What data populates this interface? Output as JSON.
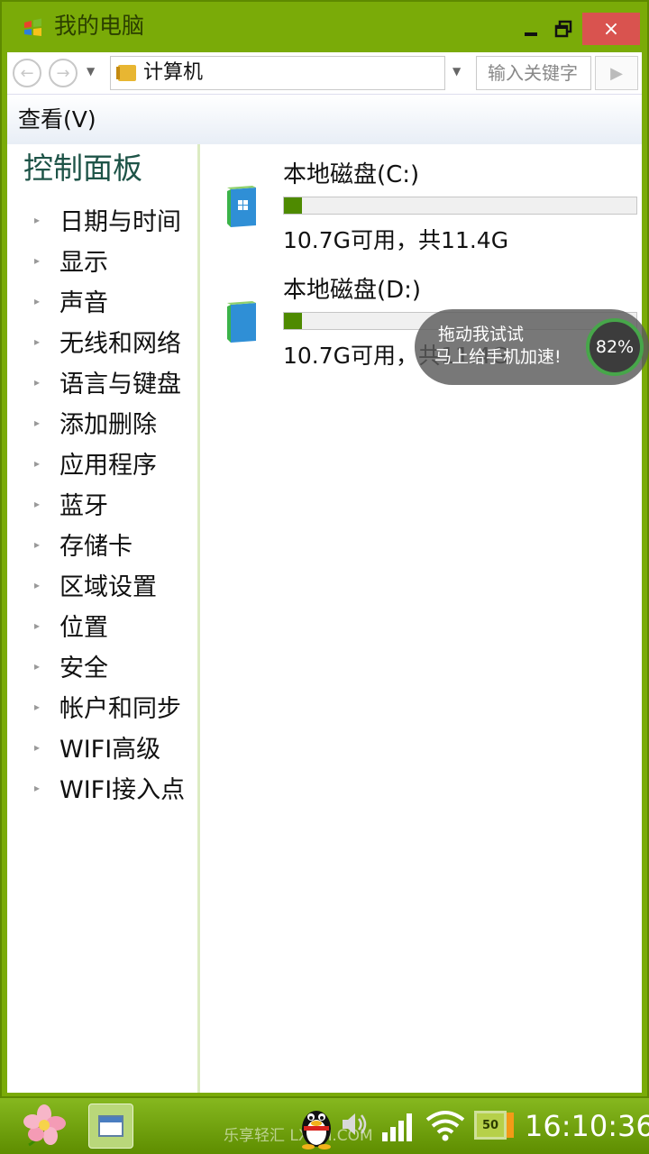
{
  "window": {
    "title": "我的电脑",
    "close_label": "×"
  },
  "address": {
    "path": "计算机",
    "search_placeholder": "输入关键字",
    "back_glyph": "←",
    "forward_glyph": "→",
    "go_glyph": "▶"
  },
  "menu": {
    "view": "查看(V)"
  },
  "sidebar": {
    "title": "控制面板",
    "items": [
      {
        "label": "日期与时间"
      },
      {
        "label": "显示"
      },
      {
        "label": "声音"
      },
      {
        "label": "无线和网络"
      },
      {
        "label": "语言与键盘"
      },
      {
        "label": "添加删除"
      },
      {
        "label": "应用程序"
      },
      {
        "label": "蓝牙"
      },
      {
        "label": "存储卡"
      },
      {
        "label": "区域设置"
      },
      {
        "label": "位置"
      },
      {
        "label": "安全"
      },
      {
        "label": "帐户和同步"
      },
      {
        "label": "WIFI高级"
      },
      {
        "label": "WIFI接入点"
      }
    ]
  },
  "drives": [
    {
      "name": "本地磁盘(C:)",
      "free": "10.7G可用，共11.4G",
      "used_fraction": 0.05,
      "icon": "windows-drive-icon"
    },
    {
      "name": "本地磁盘(D:)",
      "free": "10.7G可用，共11.4G",
      "used_fraction": 0.05,
      "icon": "drive-icon"
    }
  ],
  "floater": {
    "line1": "拖动我试试",
    "line2": "马上给手机加速!",
    "percent": "82%"
  },
  "taskbar": {
    "watermark": "乐享轻汇 LXQH.COM",
    "battery_label": "50",
    "time": "16:10:36"
  },
  "colors": {
    "window_frame": "#7aab08",
    "accent_green": "#4e8a00",
    "close_red": "#d9534f",
    "sidebar_title": "#1e5448"
  }
}
